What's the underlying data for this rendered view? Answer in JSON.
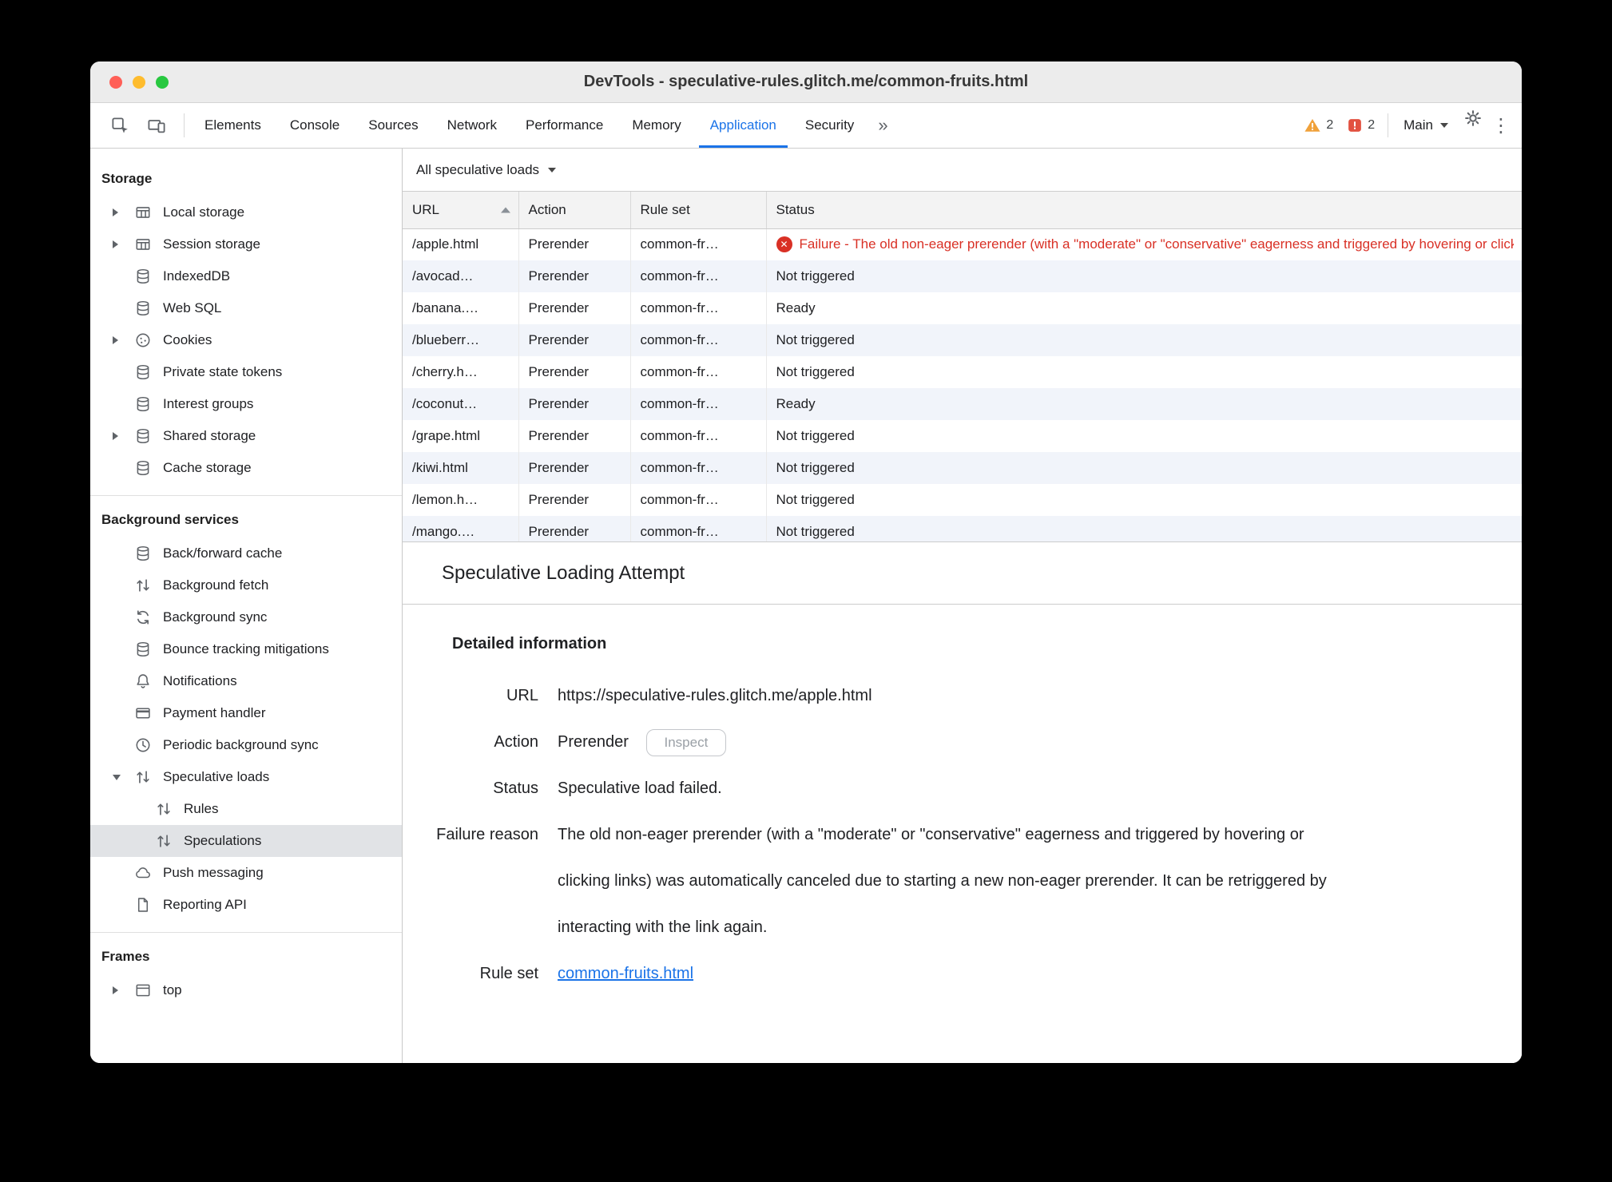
{
  "window": {
    "title": "DevTools - speculative-rules.glitch.me/common-fruits.html"
  },
  "colors": {
    "accent": "#1a73e8",
    "failure_red": "#d93025",
    "warning_orange": "#f0a13a",
    "issue_red": "#e25140"
  },
  "toolbar": {
    "tabs": [
      {
        "label": "Elements",
        "selected": false
      },
      {
        "label": "Console",
        "selected": false
      },
      {
        "label": "Sources",
        "selected": false
      },
      {
        "label": "Network",
        "selected": false
      },
      {
        "label": "Performance",
        "selected": false
      },
      {
        "label": "Memory",
        "selected": false
      },
      {
        "label": "Application",
        "selected": true
      },
      {
        "label": "Security",
        "selected": false
      }
    ],
    "overflow_label": "»",
    "warning_count": "2",
    "issue_count": "2",
    "main_label": "Main"
  },
  "sidebar": {
    "sections": [
      {
        "header": "Storage",
        "items": [
          {
            "label": "Local storage",
            "icon": "table",
            "expand": "right"
          },
          {
            "label": "Session storage",
            "icon": "table",
            "expand": "right"
          },
          {
            "label": "IndexedDB",
            "icon": "database"
          },
          {
            "label": "Web SQL",
            "icon": "database"
          },
          {
            "label": "Cookies",
            "icon": "cookie",
            "expand": "right"
          },
          {
            "label": "Private state tokens",
            "icon": "database"
          },
          {
            "label": "Interest groups",
            "icon": "database"
          },
          {
            "label": "Shared storage",
            "icon": "database",
            "expand": "right"
          },
          {
            "label": "Cache storage",
            "icon": "database"
          }
        ]
      },
      {
        "header": "Background services",
        "items": [
          {
            "label": "Back/forward cache",
            "icon": "database"
          },
          {
            "label": "Background fetch",
            "icon": "updown"
          },
          {
            "label": "Background sync",
            "icon": "sync"
          },
          {
            "label": "Bounce tracking mitigations",
            "icon": "database"
          },
          {
            "label": "Notifications",
            "icon": "bell"
          },
          {
            "label": "Payment handler",
            "icon": "card"
          },
          {
            "label": "Periodic background sync",
            "icon": "clock"
          },
          {
            "label": "Speculative loads",
            "icon": "updown",
            "expand": "down"
          },
          {
            "label": "Rules",
            "icon": "updown",
            "indent": 1
          },
          {
            "label": "Speculations",
            "icon": "updown",
            "indent": 1,
            "selected": true
          },
          {
            "label": "Push messaging",
            "icon": "cloud"
          },
          {
            "label": "Reporting API",
            "icon": "file"
          }
        ]
      },
      {
        "header": "Frames",
        "items": [
          {
            "label": "top",
            "icon": "frame",
            "expand": "right"
          }
        ]
      }
    ]
  },
  "main": {
    "filter_label": "All speculative loads",
    "table": {
      "columns": [
        "URL",
        "Action",
        "Rule set",
        "Status"
      ],
      "sort_column": "URL",
      "sort_direction": "asc",
      "rows": [
        {
          "url": "/apple.html",
          "action": "Prerender",
          "rule_set": "common-fr…",
          "status": "Failure - The old non-eager prerender (with a \"moderate\" or \"conservative\" eagerness and triggered by hovering or clicking links) was automatically canceled due to starting a new non-eager prerender.",
          "status_type": "failure"
        },
        {
          "url": "/avocad…",
          "action": "Prerender",
          "rule_set": "common-fr…",
          "status": "Not triggered",
          "status_type": "normal"
        },
        {
          "url": "/banana.…",
          "action": "Prerender",
          "rule_set": "common-fr…",
          "status": "Ready",
          "status_type": "normal"
        },
        {
          "url": "/blueberr…",
          "action": "Prerender",
          "rule_set": "common-fr…",
          "status": "Not triggered",
          "status_type": "normal"
        },
        {
          "url": "/cherry.h…",
          "action": "Prerender",
          "rule_set": "common-fr…",
          "status": "Not triggered",
          "status_type": "normal"
        },
        {
          "url": "/coconut…",
          "action": "Prerender",
          "rule_set": "common-fr…",
          "status": "Ready",
          "status_type": "normal"
        },
        {
          "url": "/grape.html",
          "action": "Prerender",
          "rule_set": "common-fr…",
          "status": "Not triggered",
          "status_type": "normal"
        },
        {
          "url": "/kiwi.html",
          "action": "Prerender",
          "rule_set": "common-fr…",
          "status": "Not triggered",
          "status_type": "normal"
        },
        {
          "url": "/lemon.h…",
          "action": "Prerender",
          "rule_set": "common-fr…",
          "status": "Not triggered",
          "status_type": "normal"
        },
        {
          "url": "/mango.…",
          "action": "Prerender",
          "rule_set": "common-fr…",
          "status": "Not triggered",
          "status_type": "normal"
        }
      ]
    },
    "detail": {
      "title": "Speculative Loading Attempt",
      "heading": "Detailed information",
      "url_label": "URL",
      "url_value": "https://speculative-rules.glitch.me/apple.html",
      "action_label": "Action",
      "action_value": "Prerender",
      "inspect_button": "Inspect",
      "status_label": "Status",
      "status_value": "Speculative load failed.",
      "failure_label": "Failure reason",
      "failure_value": "The old non-eager prerender (with a \"moderate\" or \"conservative\" eagerness and triggered by hovering or clicking links) was automatically canceled due to starting a new non-eager prerender. It can be retriggered by interacting with the link again.",
      "ruleset_label": "Rule set",
      "ruleset_value": "common-fruits.html"
    }
  }
}
